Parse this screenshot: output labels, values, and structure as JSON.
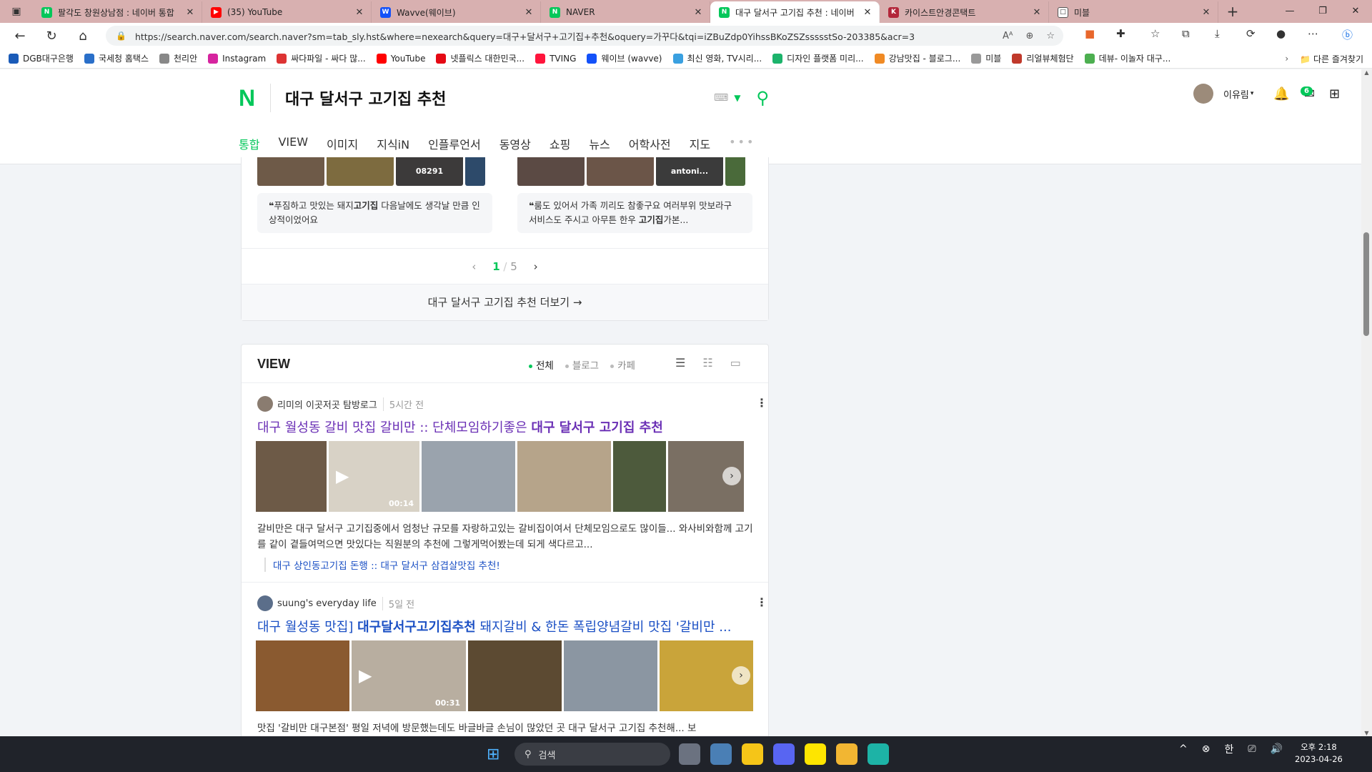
{
  "browser": {
    "tabs": [
      {
        "title": "팔각도 창원상남점 : 네이버 통합",
        "favicon_color": "#03c75a",
        "favicon_letter": "N",
        "active": false
      },
      {
        "title": "(35) YouTube",
        "favicon_color": "#ff0000",
        "favicon_letter": "▶",
        "active": false
      },
      {
        "title": "Wavve(웨이브)",
        "favicon_color": "#1351f9",
        "favicon_letter": "W",
        "active": false
      },
      {
        "title": "NAVER",
        "favicon_color": "#03c75a",
        "favicon_letter": "N",
        "active": false
      },
      {
        "title": "대구 달서구 고기집 추천 : 네이버",
        "favicon_color": "#03c75a",
        "favicon_letter": "N",
        "active": true
      },
      {
        "title": "카이스트안경콘택트",
        "favicon_color": "#b3263a",
        "favicon_letter": "K",
        "active": false
      },
      {
        "title": "미블",
        "favicon_color": "#ffffff",
        "favicon_letter": "□",
        "active": false
      }
    ],
    "url": "https://search.naver.com/search.naver?sm=tab_sly.hst&where=nexearch&query=대구+달서구+고기집+추천&oquery=가꾸다&tqi=iZBuZdp0YihssBKoZSZssssstSo-203385&acr=3",
    "bookmarks": [
      {
        "label": "DGB대구은행",
        "color": "#1a5bb8"
      },
      {
        "label": "국세청 홈택스",
        "color": "#2a6fc9"
      },
      {
        "label": "천리안",
        "color": "#888888"
      },
      {
        "label": "Instagram",
        "color": "#d6249f"
      },
      {
        "label": "싸다파일 - 싸다 많...",
        "color": "#d33"
      },
      {
        "label": "YouTube",
        "color": "#ff0000"
      },
      {
        "label": "넷플릭스 대한민국...",
        "color": "#e50914"
      },
      {
        "label": "TVING",
        "color": "#ff153c"
      },
      {
        "label": "웨이브 (wavve)",
        "color": "#1351f9"
      },
      {
        "label": "최신 영화, TV시리...",
        "color": "#3aa0e0"
      },
      {
        "label": "디자인 플랫폼 미리...",
        "color": "#1cb36b"
      },
      {
        "label": "강남맛집 - 블로그...",
        "color": "#f08a24"
      },
      {
        "label": "미블",
        "color": "#999999"
      },
      {
        "label": "리얼뷰체험단",
        "color": "#c0392b"
      },
      {
        "label": "데뷰- 이놀자 대구...",
        "color": "#4caf50"
      }
    ],
    "other_favorites": "다른 즐겨찾기"
  },
  "naver": {
    "query": "대구 달서구 고기집 추천",
    "user": "이유림",
    "mail_badge": "6",
    "tabs": [
      "통합",
      "VIEW",
      "이미지",
      "지식iN",
      "인플루언서",
      "동영상",
      "쇼핑",
      "뉴스",
      "어학사전",
      "지도",
      "•••"
    ]
  },
  "top_card": {
    "thumb_labels": [
      "08291",
      "antoni..."
    ],
    "quotes": [
      {
        "pre": "푸짐하고 맛있는 돼지",
        "bold": "고기집",
        "post": " 다음날에도 생각날 만큼 인상적이었어요"
      },
      {
        "pre": "룸도 있어서 가족 끼리도 참좋구요 여러부위 맛보라구 서비스도 주시고 아무튼 한우 ",
        "bold": "고기집",
        "post": "가본..."
      }
    ],
    "page_current": "1",
    "page_total": "5",
    "more_label": "대구 달서구 고기집 추천 더보기 →"
  },
  "view": {
    "title": "VIEW",
    "filters": [
      "전체",
      "블로그",
      "카페"
    ],
    "posts": [
      {
        "author": "리미의 이곳저곳 탐방로그",
        "time": "5시간 전",
        "title_pre": "대구 월성동 갈비 맛집 갈비만 :: 단체모임하기좋은 ",
        "title_bold": "대구 달서구 고기집 추천",
        "video_duration": "00:14",
        "desc": "갈비만은 대구 달서구 고기집중에서 엄청난 규모를 자랑하고있는 갈비집이여서 단체모임으로도 많이들... 와사비와함께 고기를 같이 곁들여먹으면 맛있다는 직원분의 추천에 그렇게먹어봤는데 되게 색다르고...",
        "sub_link": "대구 상인동고기집 돈행 :: 대구 달서구 삼겹살맛집 추천!"
      },
      {
        "author": "suung's everyday life",
        "time": "5일 전",
        "title_pre": "대구 월성동 맛집] ",
        "title_bold": "대구달서구고기집추천",
        "title_post": " 돼지갈비 & 한돈 폭립양념갈비 맛집 '갈비만 ...",
        "video_duration": "00:31",
        "desc": "맛집 '갈비만 대구본점' 평일 저녁에 방문했는데도 바글바글 손님이 많았던 곳 대구 달서구 고기집 추천해... 보"
      }
    ]
  },
  "taskbar": {
    "search_placeholder": "검색",
    "ime": "한",
    "time": "오후 2:18",
    "date": "2023-04-26"
  }
}
